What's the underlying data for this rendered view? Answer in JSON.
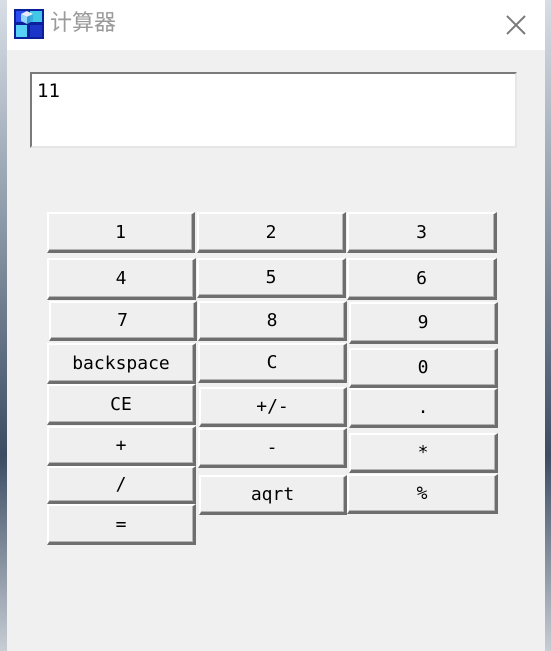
{
  "window": {
    "title": "计算器",
    "app_icon": "calculator-cube-icon",
    "close_icon": "close-icon"
  },
  "display": {
    "value": "11"
  },
  "buttons": {
    "one": "1",
    "two": "2",
    "three": "3",
    "four": "4",
    "five": "5",
    "six": "6",
    "seven": "7",
    "eight": "8",
    "nine": "9",
    "backspace": "backspace",
    "clear": "C",
    "zero": "0",
    "clear_entry": "CE",
    "sign": "+/-",
    "decimal": ".",
    "plus": "+",
    "minus": "-",
    "multiply": "*",
    "divide": "/",
    "sqrt": "aqrt",
    "percent": "%",
    "equals": "="
  },
  "colors": {
    "title_text": "#9a9a9a",
    "window_bg": "#f0f0f0",
    "button_shadow": "#6e6e6e"
  }
}
